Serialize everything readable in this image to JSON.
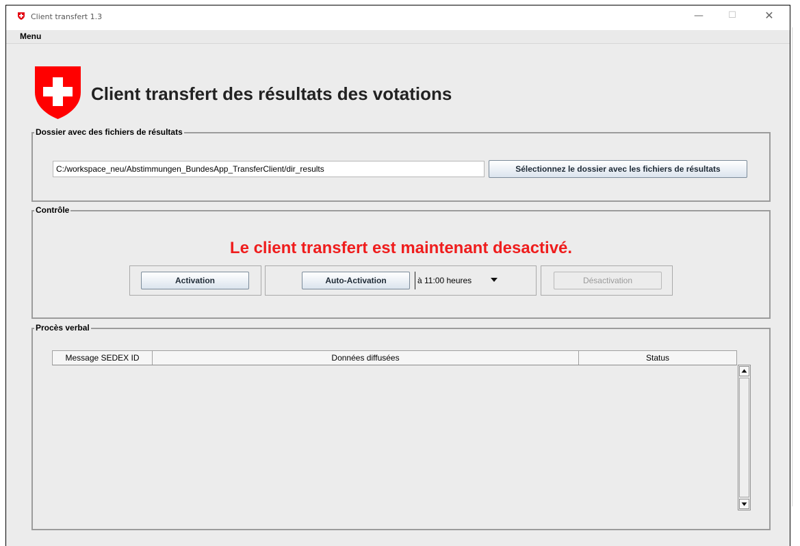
{
  "window": {
    "title": "Client transfert 1.3",
    "controls": {
      "minimize": "—",
      "maximize": "☐",
      "close": "✕"
    }
  },
  "menubar": {
    "menu_label": "Menu"
  },
  "header": {
    "title": "Client transfert des résultats des votations",
    "logo_icon": "swiss-shield-icon"
  },
  "folder_group": {
    "title": "Dossier avec des fichiers de résultats",
    "path_value": "C:/workspace_neu/Abstimmungen_BundesApp_TransferClient/dir_results",
    "browse_button": "Sélectionnez le dossier avec les fichiers de résultats"
  },
  "control_group": {
    "title": "Contrôle",
    "status_message": "Le client transfert est maintenant desactivé.",
    "activation_button": "Activation",
    "auto_activation_button": "Auto-Activation",
    "auto_time_value": "à 11:00 heures",
    "deactivation_button": "Désactivation"
  },
  "log_group": {
    "title": "Procès verbal",
    "columns": [
      "Message SEDEX ID",
      "Données diffusées",
      "Status"
    ],
    "rows": []
  },
  "colors": {
    "status_red": "#ef1d1d",
    "swiss_red": "#ff0000",
    "panel_bg": "#ececec",
    "button_gradient_top": "#ffffff",
    "button_gradient_bottom": "#dbe4ee"
  }
}
